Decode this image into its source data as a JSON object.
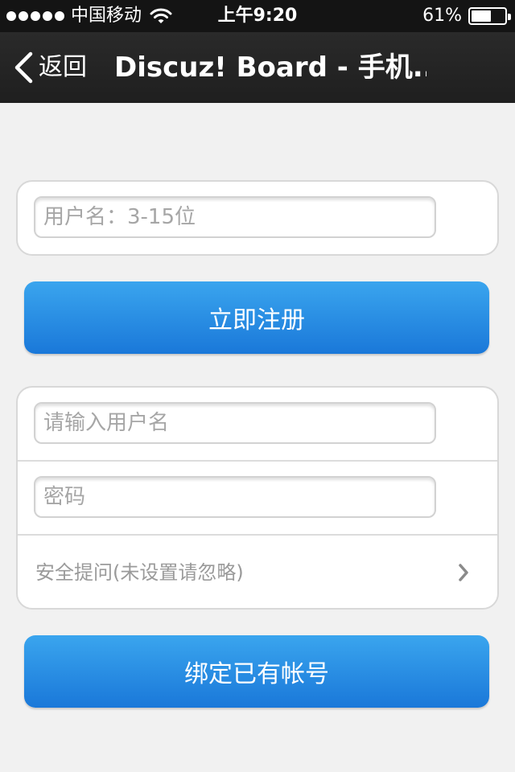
{
  "status_bar": {
    "carrier": "中国移动",
    "time": "上午9:20",
    "battery_percent": "61%",
    "battery_level": 0.61,
    "icons": [
      "signal-dots-icon",
      "wifi-icon",
      "battery-icon"
    ]
  },
  "nav": {
    "back_label": "返回",
    "title": "Discuz! Board - 手机..."
  },
  "register_form": {
    "username_placeholder": "用户名：3-15位",
    "submit_label": "立即注册"
  },
  "bind_form": {
    "username_placeholder": "请输入用户名",
    "password_placeholder": "密码",
    "security_question_label": "安全提问(未设置请忽略)",
    "submit_label": "绑定已有帐号"
  },
  "colors": {
    "button_top": "#3aa5ee",
    "button_bottom": "#1a78d9",
    "nav_background": "#262626",
    "page_background": "#f1f1f1"
  }
}
